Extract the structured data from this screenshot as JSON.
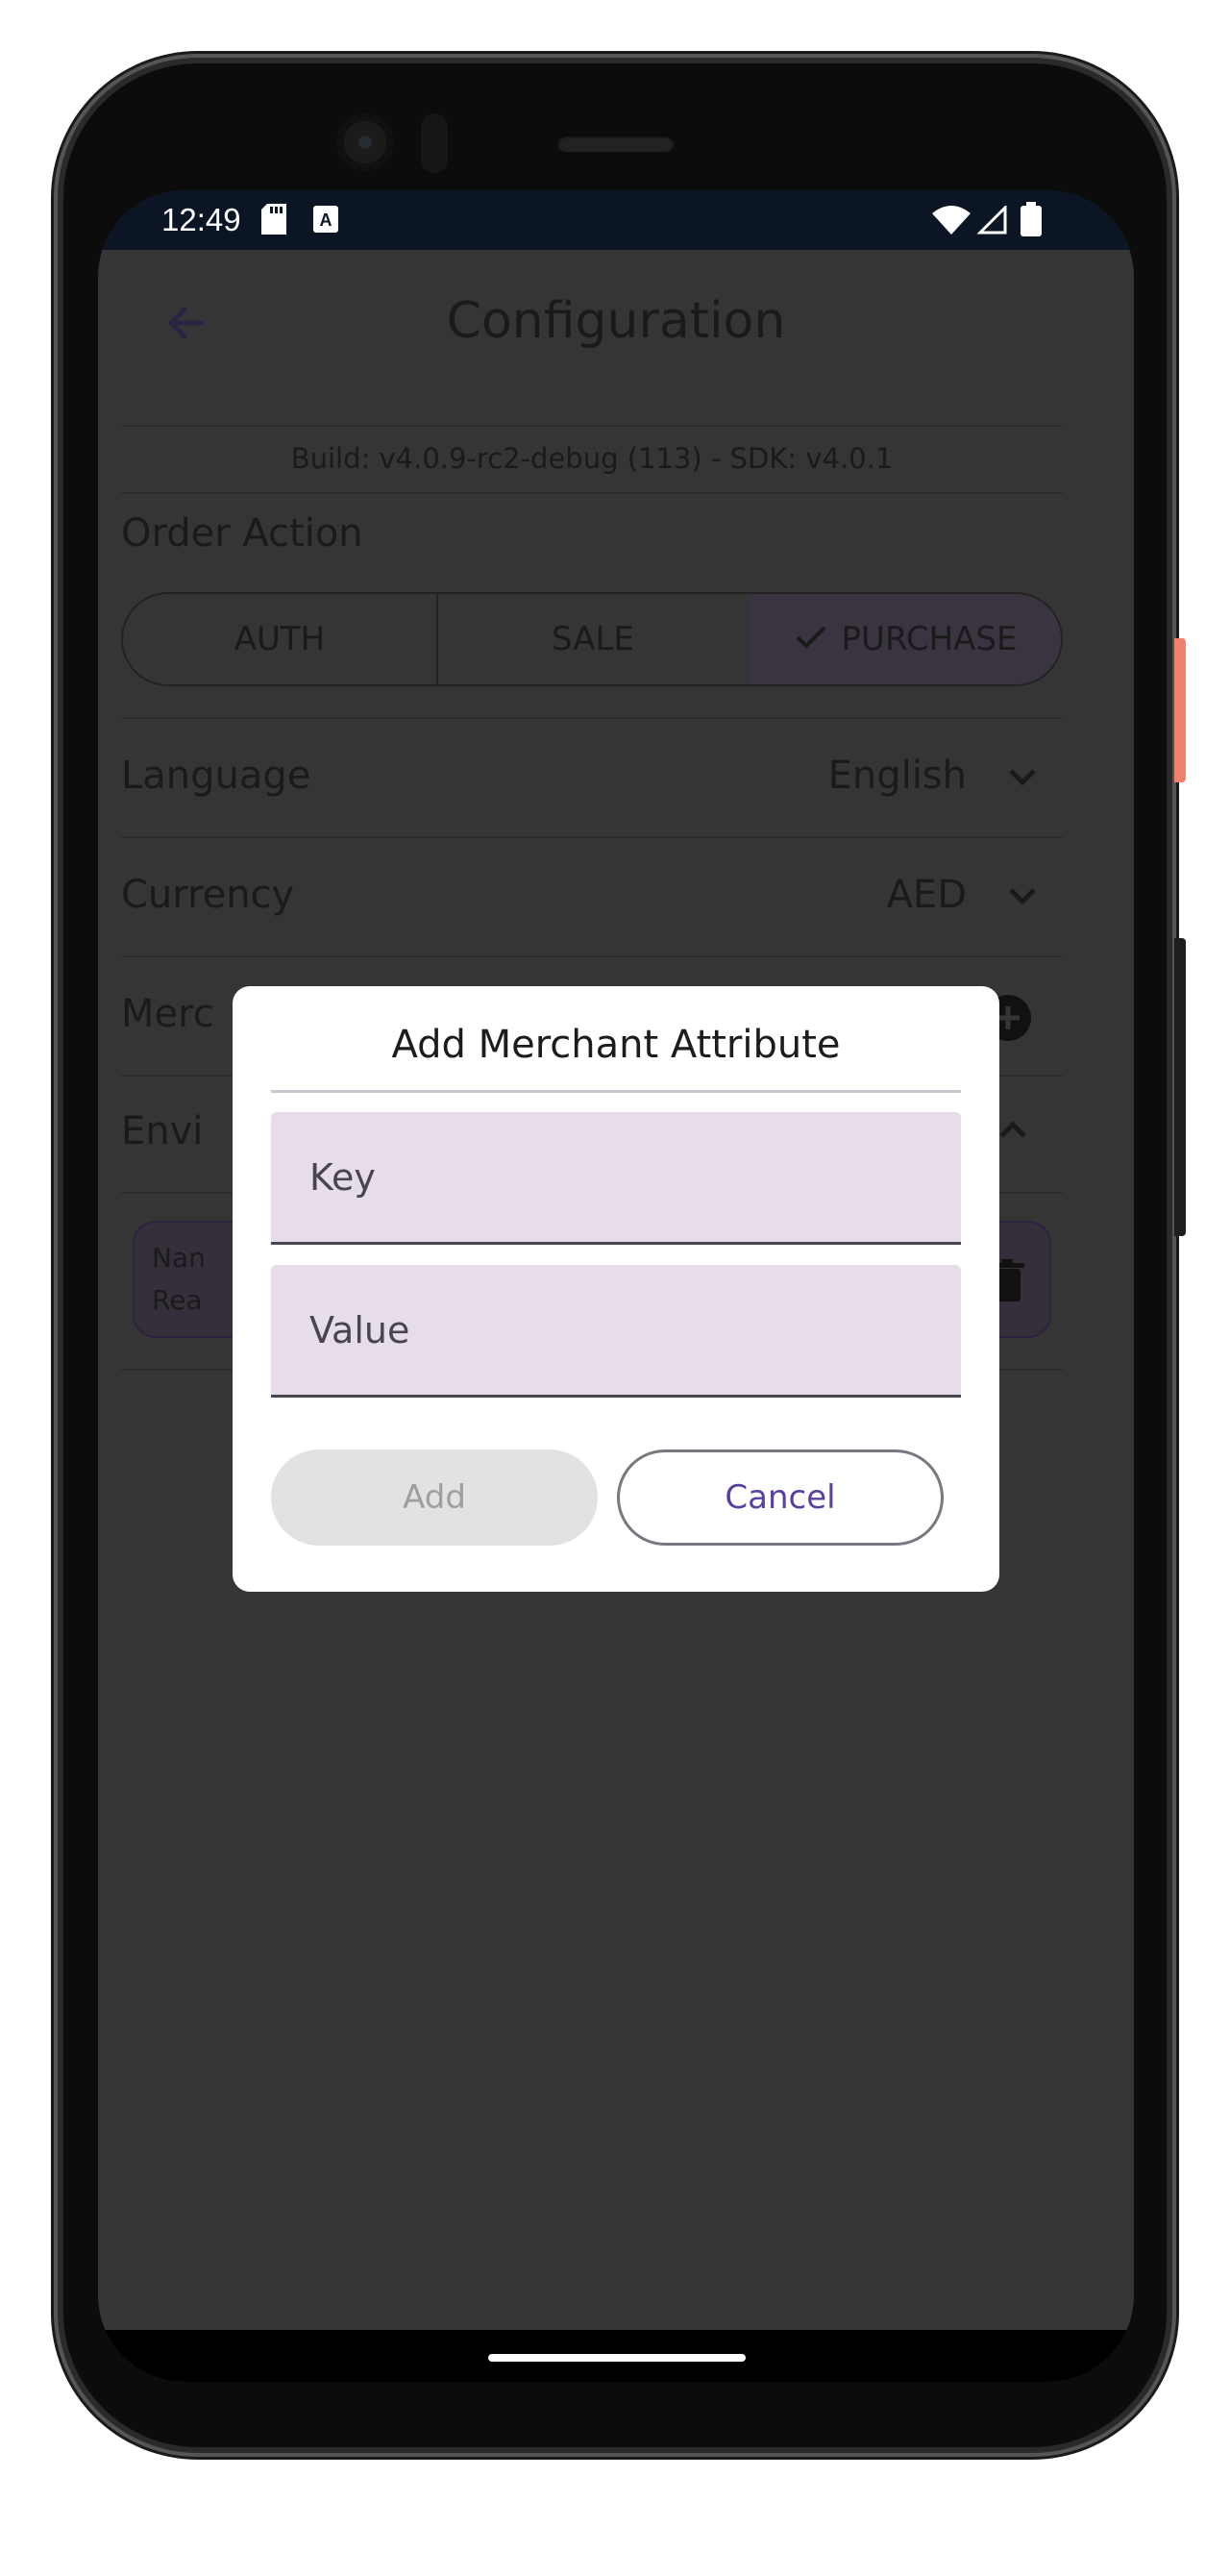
{
  "status_bar": {
    "time": "12:49",
    "left_icons": [
      "sd-card-icon",
      "a-icon"
    ],
    "right_icons": [
      "wifi-icon",
      "signal-icon",
      "battery-icon"
    ]
  },
  "app_bar": {
    "title": "Configuration",
    "back_icon": "arrow-left-icon"
  },
  "build_info": "Build: v4.0.9-rc2-debug (113) - SDK: v4.0.1",
  "order_action": {
    "label": "Order Action",
    "options": [
      "AUTH",
      "SALE",
      "PURCHASE"
    ],
    "selected": "PURCHASE"
  },
  "settings": {
    "language": {
      "label": "Language",
      "value": "English"
    },
    "currency": {
      "label": "Currency",
      "value": "AED"
    },
    "merchant_partial": "Merc",
    "environment_partial": "Envi"
  },
  "env_card": {
    "line1": "Nan",
    "line2": "Rea"
  },
  "dialog": {
    "title": "Add Merchant Attribute",
    "key_placeholder": "Key",
    "value_placeholder": "Value",
    "add_label": "Add",
    "cancel_label": "Cancel"
  },
  "colors": {
    "accent": "#5b3fa0",
    "scrim_background": "#353535",
    "field_fill": "#e6dde9",
    "status_bar": "#0b1524"
  }
}
